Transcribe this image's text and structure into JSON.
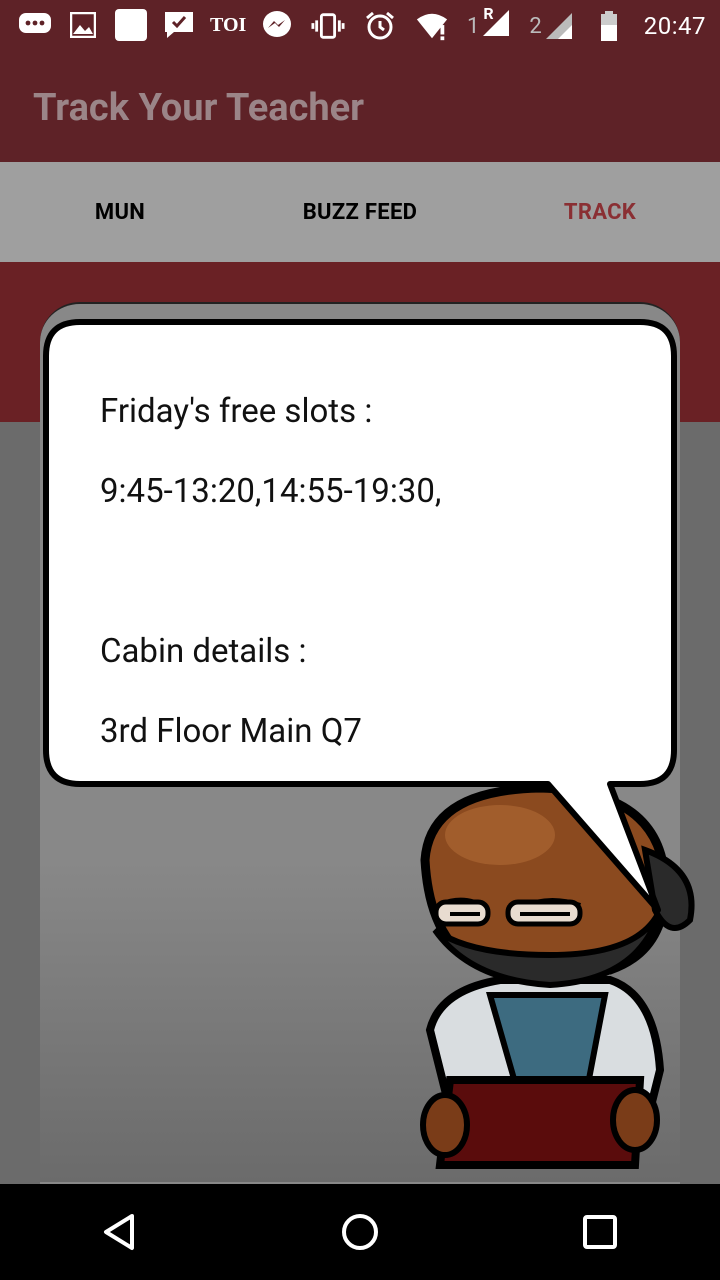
{
  "status_bar": {
    "carrier_text": "TOI",
    "sim1": "1",
    "sim1_roaming": "R",
    "sim2": "2",
    "time": "20:47"
  },
  "app_bar": {
    "title": "Track Your Teacher"
  },
  "tabs": [
    {
      "label": "MUN",
      "active": false
    },
    {
      "label": "BUZZ FEED",
      "active": false
    },
    {
      "label": "TRACK",
      "active": true
    }
  ],
  "bubble": {
    "slots_label": "Friday's free slots :",
    "slots_value": "9:45-13:20,14:55-19:30,",
    "cabin_label": "Cabin details :",
    "cabin_value": "3rd Floor Main Q7"
  },
  "colors": {
    "primary_dark": "#5e2227",
    "tab_bg": "#9f9f9f",
    "tab_active": "#8a2f33",
    "overlay_gray": "#6b6b6b"
  },
  "icons": [
    "messages-icon",
    "gallery-icon",
    "app-icon",
    "check-message-icon",
    "messenger-icon",
    "vibrate-icon",
    "alarm-icon",
    "wifi-icon",
    "signal-icon",
    "battery-icon",
    "back-icon",
    "home-icon",
    "recents-icon"
  ]
}
